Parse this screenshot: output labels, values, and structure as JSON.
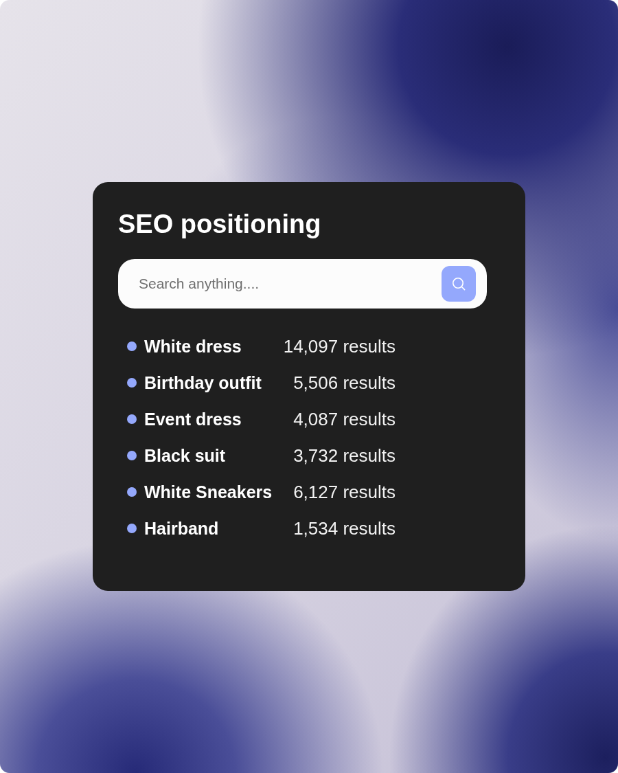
{
  "card": {
    "title": "SEO positioning",
    "search": {
      "placeholder": "Search anything...."
    },
    "keywords": [
      {
        "term": "White dress",
        "results": "14,097 results"
      },
      {
        "term": "Birthday outfit",
        "results": "5,506 results"
      },
      {
        "term": "Event dress",
        "results": "4,087 results"
      },
      {
        "term": "Black suit",
        "results": "3,732 results"
      },
      {
        "term": "White Sneakers",
        "results": "6,127 results"
      },
      {
        "term": "Hairband",
        "results": "1,534 results"
      }
    ]
  }
}
